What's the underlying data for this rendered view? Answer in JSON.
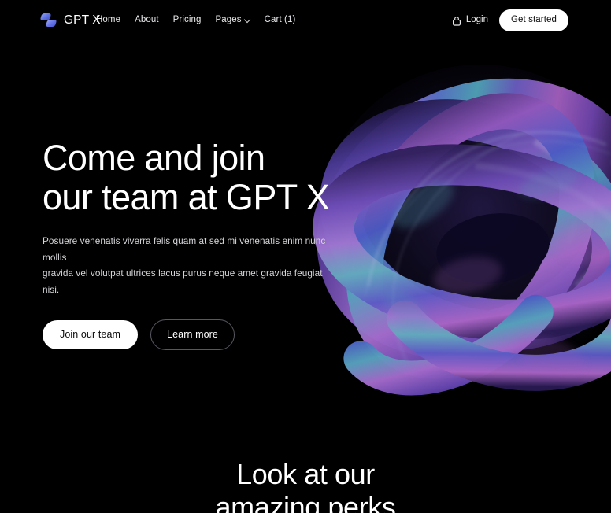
{
  "theme": {
    "background": "#000000",
    "text_primary": "#ffffff",
    "text_muted": "#d6d6da",
    "accent_button_bg": "#ffffff",
    "accent_button_text": "#0a0a0a",
    "outline_border": "#585861",
    "logo_blue": "#6472e6",
    "art_purple": "#6b3fae",
    "art_violet": "#4a3ba8",
    "art_teal": "#4f9fb5",
    "art_magenta": "#b566c4",
    "art_deep": "#1b1440"
  },
  "header": {
    "brand": {
      "icon": "logo-mark-icon",
      "name": "GPT X"
    },
    "nav": [
      {
        "label": "Home",
        "has_chevron": false
      },
      {
        "label": "About",
        "has_chevron": false
      },
      {
        "label": "Pricing",
        "has_chevron": false
      },
      {
        "label": "Pages",
        "has_chevron": true,
        "chevron_icon": "chevron-down-icon"
      },
      {
        "label": "Cart (1)",
        "has_chevron": false
      }
    ],
    "login": {
      "icon": "lock-icon",
      "label": "Login"
    },
    "cta": {
      "label": "Get started"
    }
  },
  "hero": {
    "title": "Come and join\nour team at GPT X",
    "subtitle": "Posuere venenatis viverra felis quam at sed mi venenatis enim nunc mollis\ngravida vel volutpat ultrices lacus purus neque amet gravida feugiat nisi.",
    "primary_button": "Join our team",
    "secondary_button": "Learn more",
    "artwork": "iridescent-torus-knot-3d"
  },
  "perks": {
    "title": "Look at our\namazing perks"
  }
}
